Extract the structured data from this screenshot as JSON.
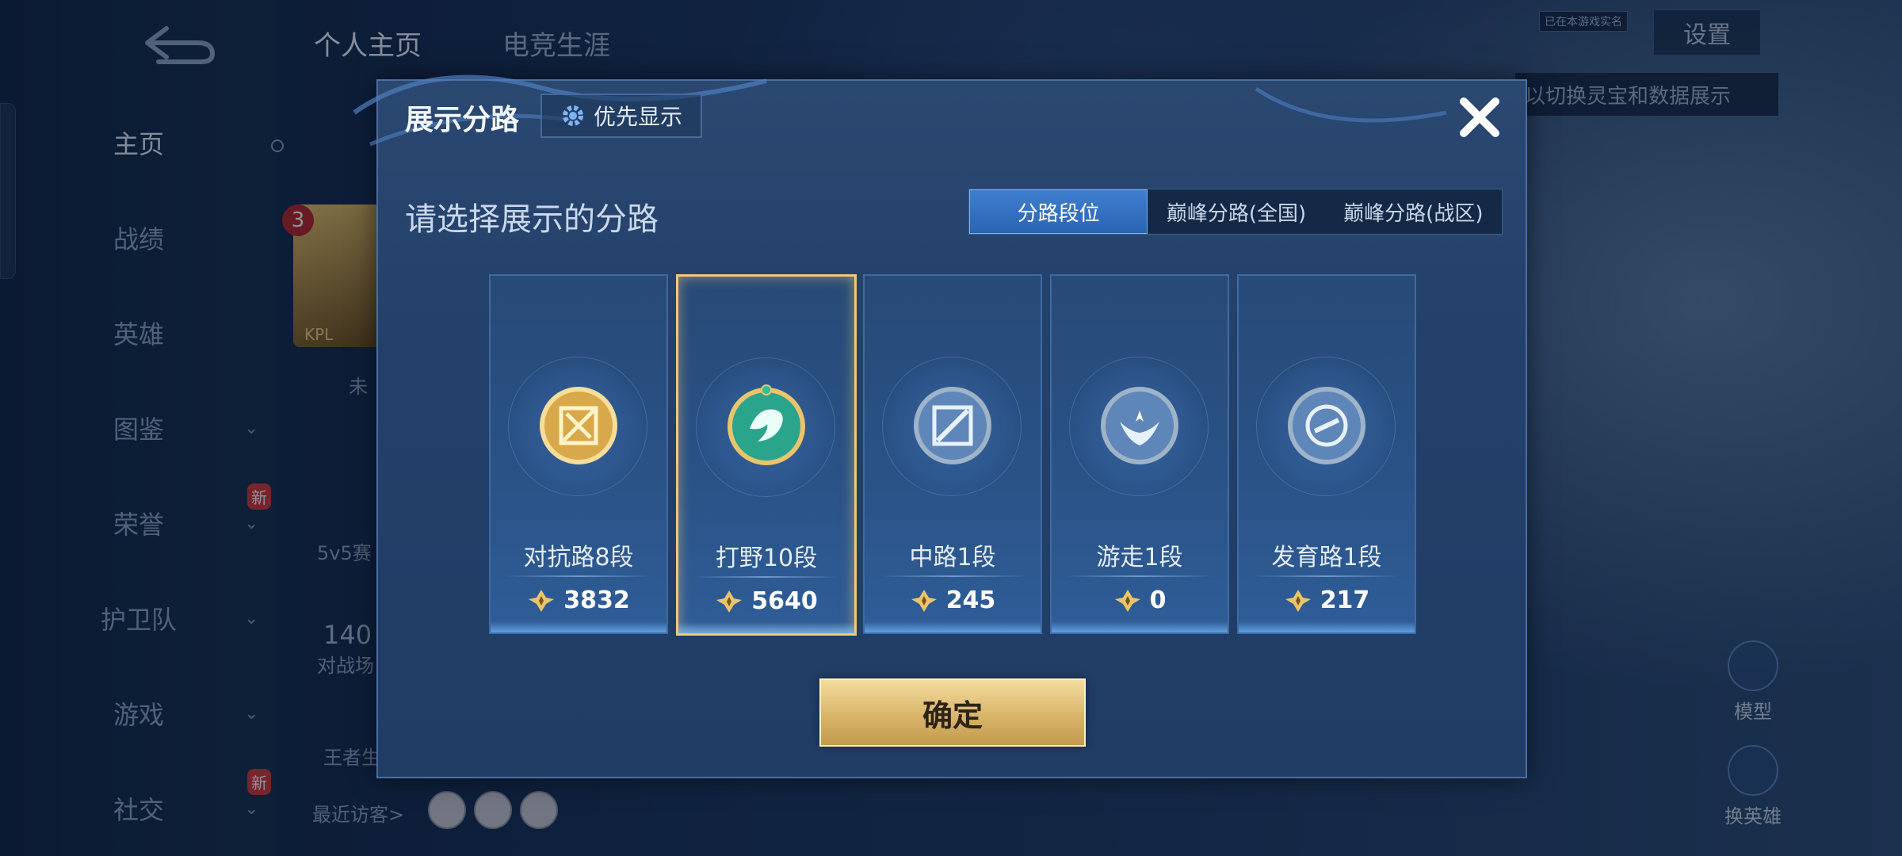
{
  "background": {
    "top_tabs": [
      "个人主页",
      "电竞生涯"
    ],
    "nav": [
      {
        "label": "主页",
        "active": true,
        "chevron": false,
        "new": false
      },
      {
        "label": "战绩",
        "active": false,
        "chevron": false,
        "new": false
      },
      {
        "label": "英雄",
        "active": false,
        "chevron": false,
        "new": false
      },
      {
        "label": "图鉴",
        "active": false,
        "chevron": true,
        "new": false
      },
      {
        "label": "荣誉",
        "active": false,
        "chevron": true,
        "new": true
      },
      {
        "label": "护卫队",
        "active": false,
        "chevron": true,
        "new": false
      },
      {
        "label": "游戏",
        "active": false,
        "chevron": true,
        "new": false
      },
      {
        "label": "社交",
        "active": false,
        "chevron": true,
        "new": true
      }
    ],
    "new_badge": "新",
    "chevron_glyph": "⌄",
    "avatar_level": "3",
    "avatar_label": "KPL",
    "side_texts": {
      "status": "未",
      "mode": "5v5赛",
      "count": "140",
      "count_label": "对战场",
      "honor": "王者生"
    },
    "recent_visitors_label": "最近访客>",
    "settings_label": "设置",
    "online_badge": "已在本游戏实名",
    "hint": "以切换灵宝和数据展示",
    "right_buttons": [
      "模型",
      "换英雄"
    ]
  },
  "dialog": {
    "title": "展示分路",
    "priority_button": "优先显示",
    "subtitle": "请选择展示的分路",
    "tabs": [
      {
        "label": "分路段位",
        "active": true
      },
      {
        "label": "巅峰分路(全国)",
        "active": false
      },
      {
        "label": "巅峰分路(战区)",
        "active": false
      }
    ],
    "lanes": [
      {
        "name": "对抗路8段",
        "score": "3832",
        "selected": false,
        "emblem": "clash-lane-icon",
        "color": "#d8a84a"
      },
      {
        "name": "打野10段",
        "score": "5640",
        "selected": true,
        "emblem": "jungle-dragon-icon",
        "color": "#2aa58c"
      },
      {
        "name": "中路1段",
        "score": "245",
        "selected": false,
        "emblem": "mid-lane-icon",
        "color": "#9fb3c8"
      },
      {
        "name": "游走1段",
        "score": "0",
        "selected": false,
        "emblem": "roam-wings-icon",
        "color": "#9fb3c8"
      },
      {
        "name": "发育路1段",
        "score": "217",
        "selected": false,
        "emblem": "farm-lane-icon",
        "color": "#9fb3c8"
      }
    ],
    "confirm_button": "确定"
  }
}
